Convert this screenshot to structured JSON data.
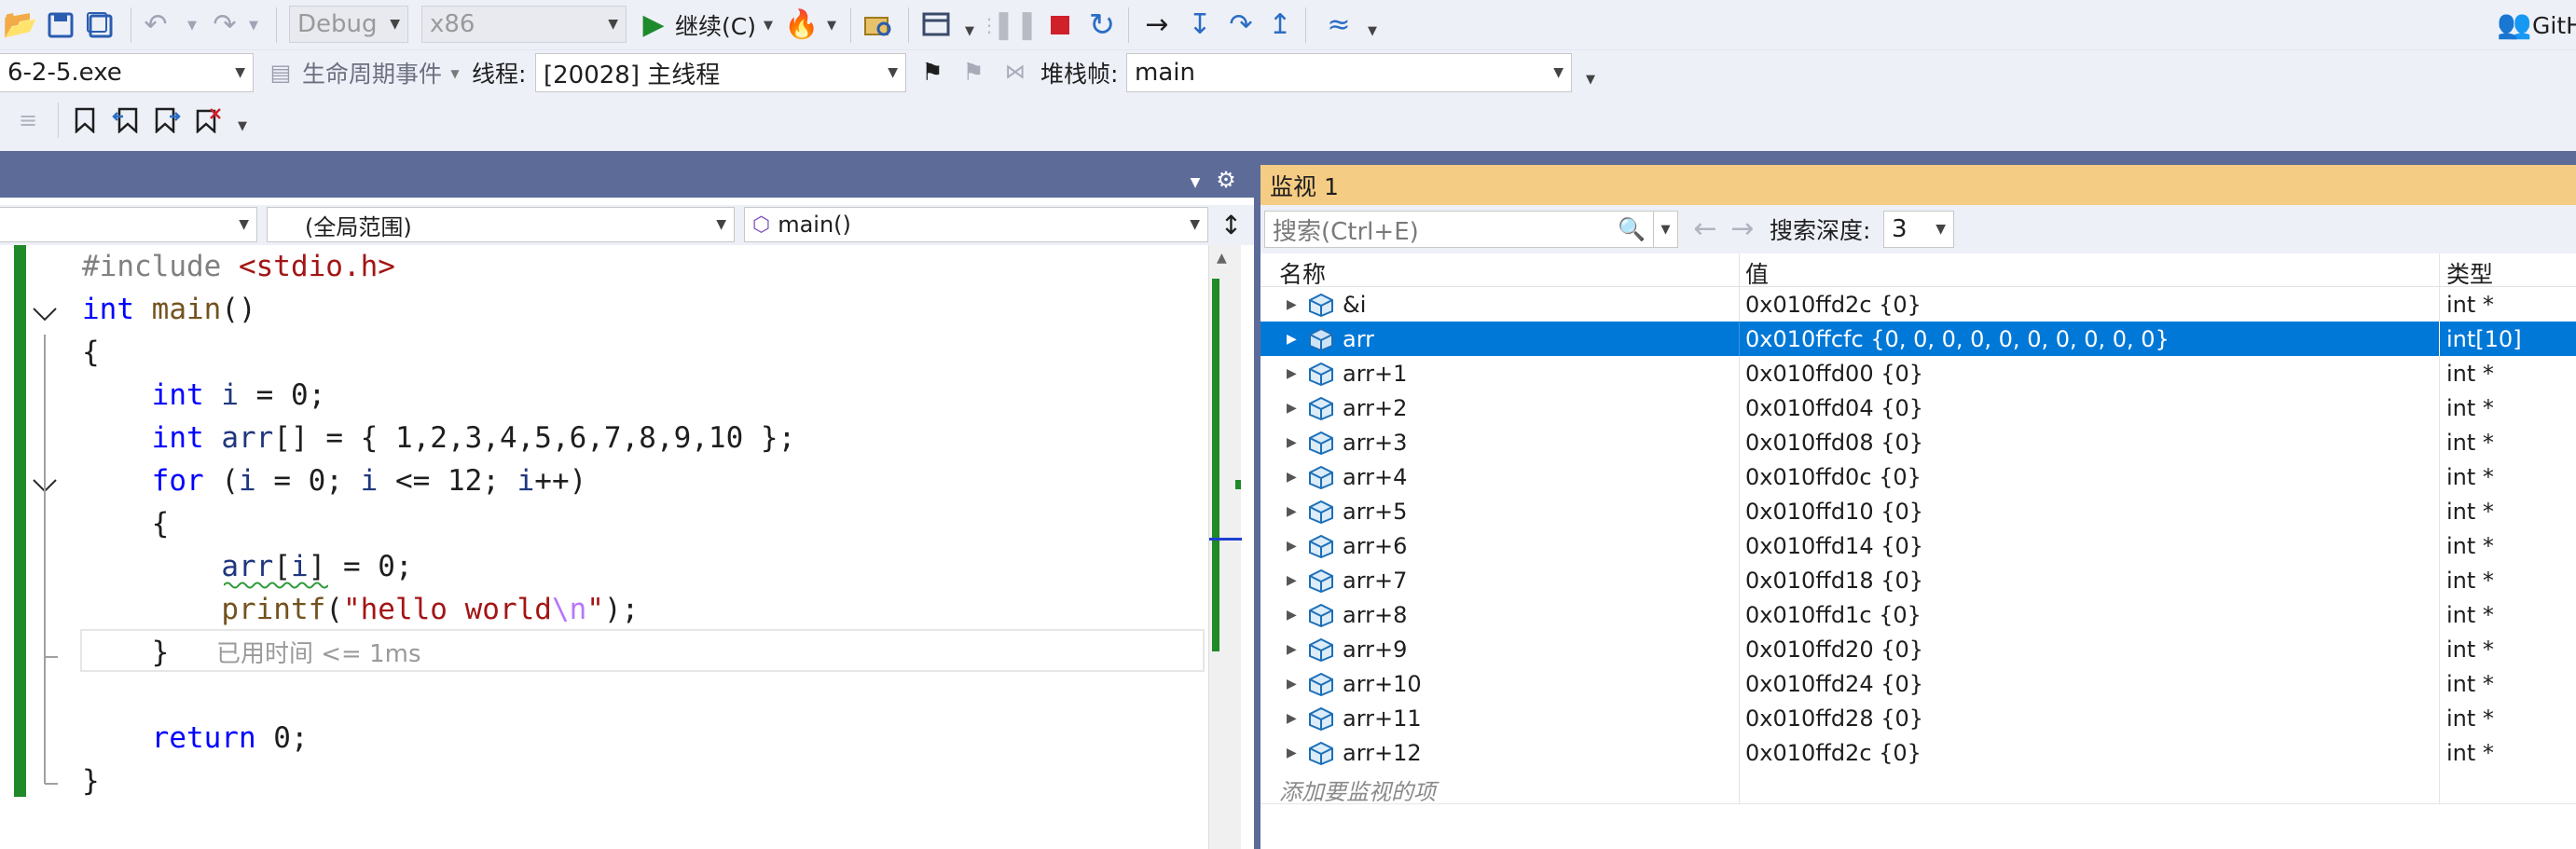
{
  "toolbar": {
    "config": "Debug",
    "platform": "x86",
    "continue_label": "继续(C)",
    "github_label": "GitH"
  },
  "debug_location": {
    "process": "6-2-5.exe",
    "lifecycle_label": "生命周期事件",
    "thread_label": "线程:",
    "thread_value": "[20028] 主线程",
    "stackframe_label": "堆栈帧:",
    "stackframe_value": "main"
  },
  "editor": {
    "scope": "(全局范围)",
    "function": "main()",
    "lines": [
      {
        "tokens": [
          [
            "pp",
            "#include "
          ],
          [
            "str",
            "<stdio.h>"
          ]
        ]
      },
      {
        "tokens": [
          [
            "kw",
            "int"
          ],
          [
            "plain",
            " "
          ],
          [
            "fn",
            "main"
          ],
          [
            "plain",
            "()"
          ]
        ]
      },
      {
        "tokens": [
          [
            "plain",
            "{"
          ]
        ]
      },
      {
        "tokens": [
          [
            "plain",
            "    "
          ],
          [
            "kw",
            "int"
          ],
          [
            "plain",
            " "
          ],
          [
            "var",
            "i"
          ],
          [
            "plain",
            " = 0;"
          ]
        ]
      },
      {
        "tokens": [
          [
            "plain",
            "    "
          ],
          [
            "kw",
            "int"
          ],
          [
            "plain",
            " "
          ],
          [
            "var",
            "arr"
          ],
          [
            "plain",
            "[] = { 1,2,3,4,5,6,7,8,9,10 };"
          ]
        ]
      },
      {
        "tokens": [
          [
            "plain",
            "    "
          ],
          [
            "kw",
            "for"
          ],
          [
            "plain",
            " ("
          ],
          [
            "var",
            "i"
          ],
          [
            "plain",
            " = 0; "
          ],
          [
            "var",
            "i"
          ],
          [
            "plain",
            " <= 12; "
          ],
          [
            "var",
            "i"
          ],
          [
            "plain",
            "++)"
          ]
        ]
      },
      {
        "tokens": [
          [
            "plain",
            "    {"
          ]
        ]
      },
      {
        "tokens": [
          [
            "plain",
            "        "
          ],
          [
            "var",
            "arr"
          ],
          [
            "plain",
            "["
          ],
          [
            "var",
            "i"
          ],
          [
            "plain",
            "] = 0;"
          ]
        ]
      },
      {
        "tokens": [
          [
            "plain",
            "        "
          ],
          [
            "fn",
            "printf"
          ],
          [
            "plain",
            "("
          ],
          [
            "str",
            "\"hello world"
          ],
          [
            "esc",
            "\\n"
          ],
          [
            "str",
            "\""
          ],
          [
            "plain",
            ");"
          ]
        ]
      },
      {
        "tokens": [
          [
            "plain",
            "    }"
          ]
        ]
      },
      {
        "tokens": []
      },
      {
        "tokens": [
          [
            "plain",
            "    "
          ],
          [
            "kw",
            "return"
          ],
          [
            "plain",
            " 0;"
          ]
        ]
      },
      {
        "tokens": [
          [
            "plain",
            "}"
          ]
        ]
      }
    ],
    "elapsed_hint": "已用时间 <= 1ms"
  },
  "watch": {
    "title": "监视 1",
    "search_placeholder": "搜索(Ctrl+E)",
    "depth_label": "搜索深度:",
    "depth_value": "3",
    "columns": {
      "name": "名称",
      "value": "值",
      "type": "类型"
    },
    "rows": [
      {
        "name": "&i",
        "value": "0x010ffd2c {0}",
        "type": "int *"
      },
      {
        "name": "arr",
        "value": "0x010ffcfc {0, 0, 0, 0, 0, 0, 0, 0, 0, 0}",
        "type": "int[10]",
        "selected": true
      },
      {
        "name": "arr+1",
        "value": "0x010ffd00 {0}",
        "type": "int *"
      },
      {
        "name": "arr+2",
        "value": "0x010ffd04 {0}",
        "type": "int *"
      },
      {
        "name": "arr+3",
        "value": "0x010ffd08 {0}",
        "type": "int *"
      },
      {
        "name": "arr+4",
        "value": "0x010ffd0c {0}",
        "type": "int *"
      },
      {
        "name": "arr+5",
        "value": "0x010ffd10 {0}",
        "type": "int *"
      },
      {
        "name": "arr+6",
        "value": "0x010ffd14 {0}",
        "type": "int *"
      },
      {
        "name": "arr+7",
        "value": "0x010ffd18 {0}",
        "type": "int *"
      },
      {
        "name": "arr+8",
        "value": "0x010ffd1c {0}",
        "type": "int *"
      },
      {
        "name": "arr+9",
        "value": "0x010ffd20 {0}",
        "type": "int *"
      },
      {
        "name": "arr+10",
        "value": "0x010ffd24 {0}",
        "type": "int *"
      },
      {
        "name": "arr+11",
        "value": "0x010ffd28 {0}",
        "type": "int *"
      },
      {
        "name": "arr+12",
        "value": "0x010ffd2c {0}",
        "type": "int *"
      }
    ],
    "add_item_hint": "添加要监视的项"
  },
  "colors": {
    "accent": "#0078d7",
    "title_bar": "#5d6b99",
    "watch_title": "#f5cc84",
    "green_margin": "#1f8a27"
  }
}
